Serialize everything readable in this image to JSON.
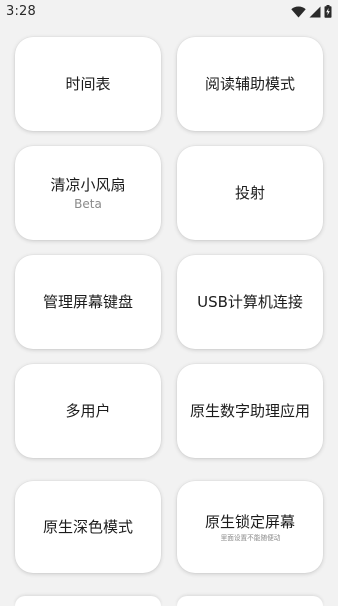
{
  "status_bar": {
    "time": "3:28",
    "icons": [
      "wifi-icon",
      "signal-icon",
      "battery-charging-icon"
    ]
  },
  "tiles": [
    {
      "label": "时间表"
    },
    {
      "label": "阅读辅助模式"
    },
    {
      "label": "清凉小风扇",
      "sublabel": "Beta"
    },
    {
      "label": "投射"
    },
    {
      "label": "管理屏幕键盘"
    },
    {
      "label": "USB计算机连接"
    },
    {
      "label": "多用户"
    },
    {
      "label": "原生数字助理应用"
    },
    {
      "label": "原生深色模式"
    },
    {
      "label": "原生锁定屏幕",
      "sublabel": "里面设置不能随便动"
    }
  ]
}
